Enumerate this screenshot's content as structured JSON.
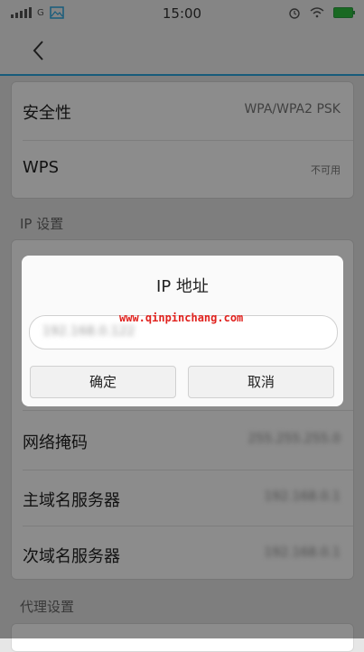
{
  "status_bar": {
    "network_type": "G",
    "time": "15:00"
  },
  "security": {
    "label": "安全性",
    "value": "WPA/WPA2 PSK"
  },
  "wps": {
    "label": "WPS",
    "value": "不可用"
  },
  "ip_section": {
    "header": "IP 设置"
  },
  "netmask": {
    "label": "网络掩码",
    "value": "255.255.255.0"
  },
  "dns1": {
    "label": "主域名服务器",
    "value": "192.168.0.1"
  },
  "dns2": {
    "label": "次域名服务器",
    "value": "192.168.0.1"
  },
  "proxy_section": {
    "header": "代理设置"
  },
  "dialog": {
    "title": "IP 地址",
    "ip_value": "192.168.0.122",
    "watermark": "www.qinpinchang.com",
    "confirm_label": "确定",
    "cancel_label": "取消"
  },
  "colors": {
    "accent": "#2aa6e0",
    "battery": "#2fbf3f",
    "watermark": "#e0211d"
  }
}
